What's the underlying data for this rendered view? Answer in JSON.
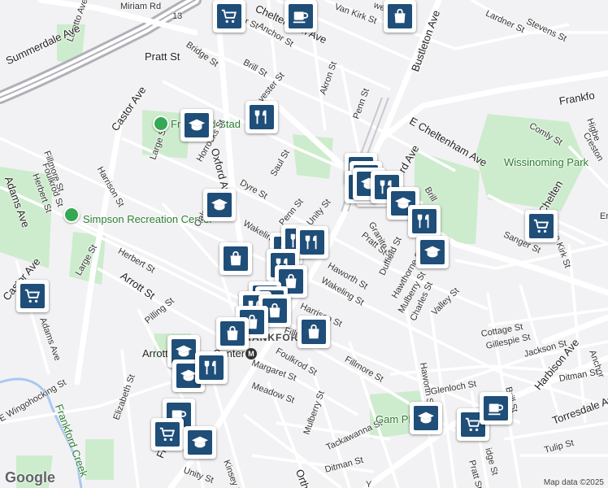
{
  "map": {
    "logo": "Google",
    "attribution": "Map data ©2025",
    "labels": [
      {
        "id": "miriam-rd",
        "text": "Miriam Rd"
      },
      {
        "id": "rt-13",
        "text": "13"
      },
      {
        "id": "pratt-st-nw",
        "text": "Pratt St"
      },
      {
        "id": "loretto-ave",
        "text": "Loretto Ave"
      },
      {
        "id": "summerdale-ave",
        "text": "Summerdale Ave"
      },
      {
        "id": "bridge-st",
        "text": "Bridge St"
      },
      {
        "id": "anchor-st",
        "text": "Anchor St"
      },
      {
        "id": "ger-st",
        "text": "nger St"
      },
      {
        "id": "cheltenham-ave-n",
        "text": "Cheltenham Ave"
      },
      {
        "id": "van-kirk-st-n",
        "text": "Van Kirk St"
      },
      {
        "id": "well-st",
        "text": "well St"
      },
      {
        "id": "bustleton-ave",
        "text": "Bustleton Ave"
      },
      {
        "id": "lardner-st",
        "text": "Lardner St"
      },
      {
        "id": "stevens-st",
        "text": "Stevens St"
      },
      {
        "id": "brill-st-n",
        "text": "Brill St"
      },
      {
        "id": "akron-st",
        "text": "Akron St"
      },
      {
        "id": "vester-st",
        "text": "vester St"
      },
      {
        "id": "penn-st-n",
        "text": "Penn St"
      },
      {
        "id": "e-cheltenham-ave",
        "text": "E Cheltenham Ave"
      },
      {
        "id": "frankford-ne",
        "text": "Frankfo"
      },
      {
        "id": "comly-st",
        "text": "Comly St"
      },
      {
        "id": "higbee",
        "text": "Higbe"
      },
      {
        "id": "creston-st",
        "text": "Creston"
      },
      {
        "id": "wissinoming-park",
        "text": "Wissinoming Park"
      },
      {
        "id": "castor-ave-n",
        "text": "Castor Ave"
      },
      {
        "id": "frankford-stadium",
        "text": "Frankford Stad"
      },
      {
        "id": "fillmore-st-w",
        "text": "Fillmore St"
      },
      {
        "id": "foulkrod-st-w",
        "text": "Foulkrod St"
      },
      {
        "id": "adams-ave-w",
        "text": "Adams Ave"
      },
      {
        "id": "herbert-st-w",
        "text": "Herbert St"
      },
      {
        "id": "harrison-st-w",
        "text": "Harrison St"
      },
      {
        "id": "large-st-n",
        "text": "Large St"
      },
      {
        "id": "horrocks-st",
        "text": "Horrocks St"
      },
      {
        "id": "oxford-ave",
        "text": "Oxford Ave"
      },
      {
        "id": "dyre-st",
        "text": "Dyre St"
      },
      {
        "id": "saul-st",
        "text": "Saul St"
      },
      {
        "id": "frankford-ave-n",
        "text": "ord Ave"
      },
      {
        "id": "brill-st-e",
        "text": "Brill"
      },
      {
        "id": "e-chelten-ave",
        "text": "E Chelten"
      },
      {
        "id": "van-kirk-st-e",
        "text": "Van Kirk St"
      },
      {
        "id": "erdrick",
        "text": "Erd"
      },
      {
        "id": "simpson-rec",
        "text": "Simpson Recreation Center"
      },
      {
        "id": "oak-st",
        "text": "Oak"
      },
      {
        "id": "wakeling-st-n",
        "text": "Wakeling St"
      },
      {
        "id": "penn-st-mid",
        "text": "Penn St"
      },
      {
        "id": "unity-st-n",
        "text": "Unity St"
      },
      {
        "id": "granite-st",
        "text": "Granite St"
      },
      {
        "id": "pratt-st-e",
        "text": "Pratt St"
      },
      {
        "id": "duffield-st",
        "text": "Duffield St"
      },
      {
        "id": "sanger-st",
        "text": "Sanger St"
      },
      {
        "id": "large-st-s",
        "text": "Large St"
      },
      {
        "id": "herbert-st-s",
        "text": "Herbert St"
      },
      {
        "id": "castor-ave-s",
        "text": "Castor Ave"
      },
      {
        "id": "arrott-st",
        "text": "Arrott St"
      },
      {
        "id": "haworth-st-n",
        "text": "Haworth St"
      },
      {
        "id": "wakeling-st-s",
        "text": "Wakeling St"
      },
      {
        "id": "hawthorne-st",
        "text": "Hawthorne St"
      },
      {
        "id": "mulberry-st-e",
        "text": "Mulberry St"
      },
      {
        "id": "charles-st",
        "text": "Charles St"
      },
      {
        "id": "valley-st",
        "text": "Valley St"
      },
      {
        "id": "adams-ave-s",
        "text": "Adams Ave"
      },
      {
        "id": "harrison-st-s",
        "text": "Harrison St"
      },
      {
        "id": "pilling-st",
        "text": "Pilling St"
      },
      {
        "id": "frankford-place",
        "text": "FRANKFORD"
      },
      {
        "id": "fillmore-st-mid",
        "text": "Fillm"
      },
      {
        "id": "foulkrod-st-s",
        "text": "Foulkrod St"
      },
      {
        "id": "arrott-label",
        "text": "Arrott"
      },
      {
        "id": "center-label",
        "text": "Center"
      },
      {
        "id": "fillmore-st-s",
        "text": "Fillmore St"
      },
      {
        "id": "haworth-st-s",
        "text": "Haworth St"
      },
      {
        "id": "cottage-st",
        "text": "Cottage St"
      },
      {
        "id": "gillespie-st",
        "text": "Gillespie St"
      },
      {
        "id": "jackson-st",
        "text": "Jackson St"
      },
      {
        "id": "anchor-st-e",
        "text": "Anchor"
      },
      {
        "id": "harbison-ave",
        "text": "Harbison Ave"
      },
      {
        "id": "ditman-st-e",
        "text": "Ditman St"
      },
      {
        "id": "margaret-st",
        "text": "Margaret St"
      },
      {
        "id": "meadow-st",
        "text": "Meadow St"
      },
      {
        "id": "glenloch-st",
        "text": "Glenloch St"
      },
      {
        "id": "brill-st-s",
        "text": "Brill St"
      },
      {
        "id": "torresdale-ave",
        "text": "Torresdale Ave"
      },
      {
        "id": "wingohocking-st",
        "text": "E Wingohocking St"
      },
      {
        "id": "elizabeth-st",
        "text": "Elizabeth St"
      },
      {
        "id": "frankford-creek",
        "text": "Frankford Creek"
      },
      {
        "id": "frankford-ave-s",
        "text": "Frankford Ave"
      },
      {
        "id": "paul-st",
        "text": "Paul St"
      },
      {
        "id": "kinsey-st",
        "text": "Kinsey St"
      },
      {
        "id": "mulberry-st-s",
        "text": "Mulberry St"
      },
      {
        "id": "tackawanna-st",
        "text": "Tackawanna St"
      },
      {
        "id": "gambrel-playground",
        "text": "Gam Playgr"
      },
      {
        "id": "pratt-st-s",
        "text": "Pratt St"
      },
      {
        "id": "bridge-st-s",
        "text": "idge St"
      },
      {
        "id": "tulip-st",
        "text": "Tulip St"
      },
      {
        "id": "unity-st-s",
        "text": "Unity St"
      },
      {
        "id": "orthodox-st",
        "text": "Ortho"
      },
      {
        "id": "ditman-st-s",
        "text": "Ditman St"
      },
      {
        "id": "york-st",
        "text": "Y"
      }
    ],
    "pois": [
      {
        "icon": "grocery-cart-icon",
        "kind": "grocery"
      },
      {
        "icon": "cafe-cup-icon",
        "kind": "cafe"
      },
      {
        "icon": "shopping-bag-icon",
        "kind": "shopping"
      },
      {
        "icon": "restaurant-icon",
        "kind": "restaurant"
      },
      {
        "icon": "school-icon",
        "kind": "school"
      }
    ],
    "park_pins": [
      "park-pin-icon"
    ]
  }
}
